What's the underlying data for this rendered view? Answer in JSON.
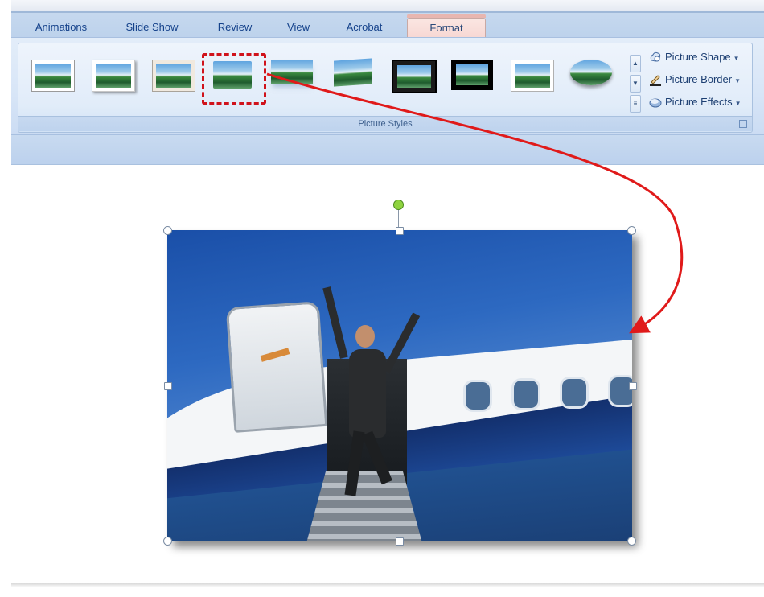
{
  "tabs": [
    {
      "label": "Animations",
      "active": false
    },
    {
      "label": "Slide Show",
      "active": false
    },
    {
      "label": "Review",
      "active": false
    },
    {
      "label": "View",
      "active": false
    },
    {
      "label": "Acrobat",
      "active": false
    },
    {
      "label": "Format",
      "active": true
    }
  ],
  "ribbon": {
    "group_label": "Picture Styles",
    "gallery": {
      "style_count": 10,
      "selected_index": 4,
      "icons": [
        "style-simple-frame-white",
        "style-soft-edge",
        "style-beveled-matte",
        "style-reflected-rounded",
        "style-reflected-bevel",
        "style-perspective-shadow",
        "style-thick-frame-black",
        "style-metal-frame",
        "style-center-shadow",
        "style-oval"
      ]
    },
    "commands": {
      "shape": "Picture Shape",
      "border": "Picture Border",
      "effects": "Picture Effects"
    }
  },
  "annotation": {
    "selection_color": "#d0121b",
    "arrow_color": "#e01a1a"
  },
  "slide": {
    "picture": "photo-man-waving-on-airplane-stairs"
  },
  "colors": {
    "ribbon_bg": "#dbe7f7",
    "tab_text": "#15428b",
    "active_tab": "#f6d6d2"
  }
}
